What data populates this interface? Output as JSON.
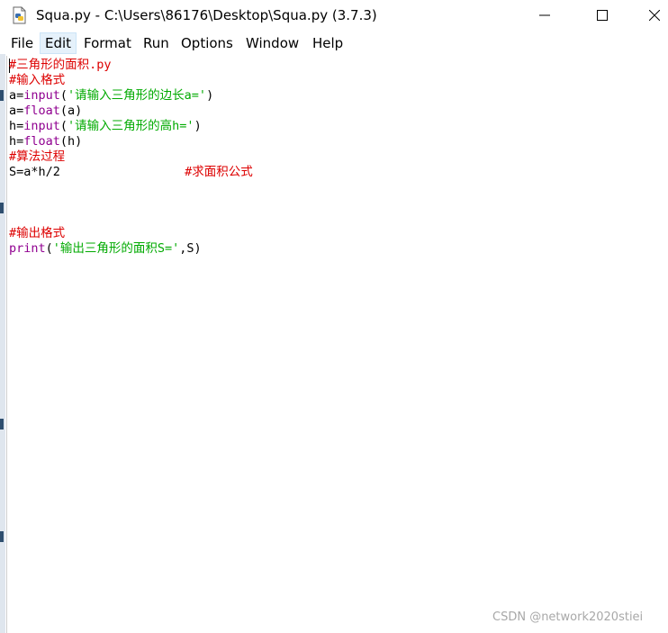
{
  "window": {
    "title": "Squa.py - C:\\Users\\86176\\Desktop\\Squa.py (3.7.3)",
    "app_icon": "python-file-icon"
  },
  "menubar": {
    "items": [
      "File",
      "Edit",
      "Format",
      "Run",
      "Options",
      "Window",
      "Help"
    ],
    "active": "Edit"
  },
  "editor": {
    "lines": [
      [
        {
          "text": "#三角形的面积.py",
          "kind": "comment"
        }
      ],
      [
        {
          "text": "#输入格式",
          "kind": "comment"
        }
      ],
      [
        {
          "text": "a=",
          "kind": "default"
        },
        {
          "text": "input",
          "kind": "builtin"
        },
        {
          "text": "(",
          "kind": "default"
        },
        {
          "text": "'请输入三角形的边长a='",
          "kind": "string"
        },
        {
          "text": ")",
          "kind": "default"
        }
      ],
      [
        {
          "text": "a=",
          "kind": "default"
        },
        {
          "text": "float",
          "kind": "builtin"
        },
        {
          "text": "(a)",
          "kind": "default"
        }
      ],
      [
        {
          "text": "h=",
          "kind": "default"
        },
        {
          "text": "input",
          "kind": "builtin"
        },
        {
          "text": "(",
          "kind": "default"
        },
        {
          "text": "'请输入三角形的高h='",
          "kind": "string"
        },
        {
          "text": ")",
          "kind": "default"
        }
      ],
      [
        {
          "text": "h=",
          "kind": "default"
        },
        {
          "text": "float",
          "kind": "builtin"
        },
        {
          "text": "(h)",
          "kind": "default"
        }
      ],
      [
        {
          "text": "#算法过程",
          "kind": "comment"
        }
      ],
      [
        {
          "text": "S=a*h/2                 ",
          "kind": "default"
        },
        {
          "text": "#求面积公式",
          "kind": "comment"
        }
      ],
      [],
      [],
      [],
      [
        {
          "text": "#输出格式",
          "kind": "comment"
        }
      ],
      [
        {
          "text": "print",
          "kind": "builtin"
        },
        {
          "text": "(",
          "kind": "default"
        },
        {
          "text": "'输出三角形的面积S='",
          "kind": "string"
        },
        {
          "text": ",S)",
          "kind": "default"
        }
      ]
    ]
  },
  "watermark": "CSDN @network2020stiei"
}
